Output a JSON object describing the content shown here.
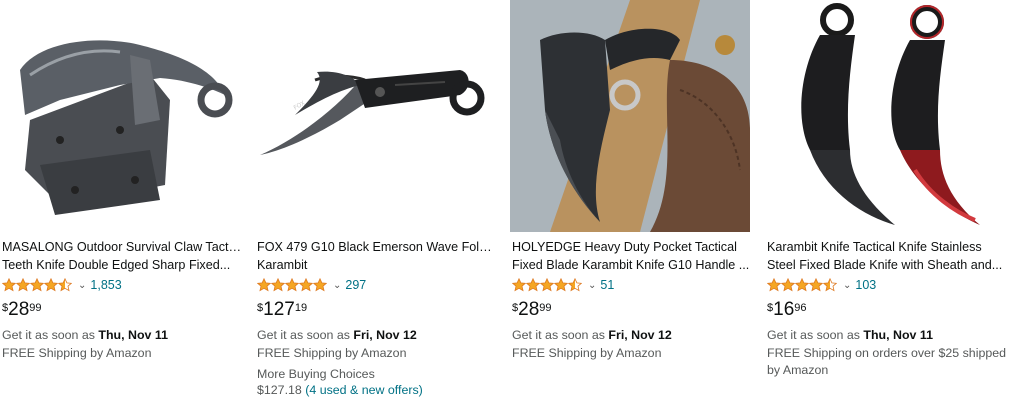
{
  "colors": {
    "star": "#f5a623",
    "link": "#007185",
    "text": "#0f1111",
    "muted": "#565959"
  },
  "products": [
    {
      "title_line1": "MASALONG Outdoor Survival Claw Tactical",
      "title_line2": "Teeth Knife Double Edged Sharp Fixed...",
      "rating": 4.5,
      "review_count": "1,853",
      "price_symbol": "$",
      "price_whole": "28",
      "price_fraction": "99",
      "delivery_prefix": "Get it as soon as ",
      "delivery_date": "Thu, Nov 11",
      "shipping": "FREE Shipping by Amazon",
      "shipping_line2": "",
      "more_choices_label": "",
      "more_choices_price": "",
      "more_choices_offers": ""
    },
    {
      "title_line1": "FOX 479 G10 Black Emerson Wave Folding",
      "title_line2": "Karambit",
      "rating": 5,
      "review_count": "297",
      "price_symbol": "$",
      "price_whole": "127",
      "price_fraction": "19",
      "delivery_prefix": "Get it as soon as ",
      "delivery_date": "Fri, Nov 12",
      "shipping": "FREE Shipping by Amazon",
      "shipping_line2": "",
      "more_choices_label": "More Buying Choices",
      "more_choices_price": "$127.18",
      "more_choices_offers": "(4 used & new offers)"
    },
    {
      "title_line1": "HOLYEDGE Heavy Duty Pocket Tactical",
      "title_line2": "Fixed Blade Karambit Knife G10 Handle ...",
      "rating": 4.5,
      "review_count": "51",
      "price_symbol": "$",
      "price_whole": "28",
      "price_fraction": "99",
      "delivery_prefix": "Get it as soon as ",
      "delivery_date": "Fri, Nov 12",
      "shipping": "FREE Shipping by Amazon",
      "shipping_line2": "",
      "more_choices_label": "",
      "more_choices_price": "",
      "more_choices_offers": ""
    },
    {
      "title_line1": "Karambit Knife Tactical Knife Stainless",
      "title_line2": "Steel Fixed Blade Knife with Sheath and...",
      "rating": 4.5,
      "review_count": "103",
      "price_symbol": "$",
      "price_whole": "16",
      "price_fraction": "96",
      "delivery_prefix": "Get it as soon as ",
      "delivery_date": "Thu, Nov 11",
      "shipping": "FREE Shipping on orders over $25 shipped",
      "shipping_line2": "by Amazon",
      "more_choices_label": "",
      "more_choices_price": "",
      "more_choices_offers": ""
    }
  ]
}
